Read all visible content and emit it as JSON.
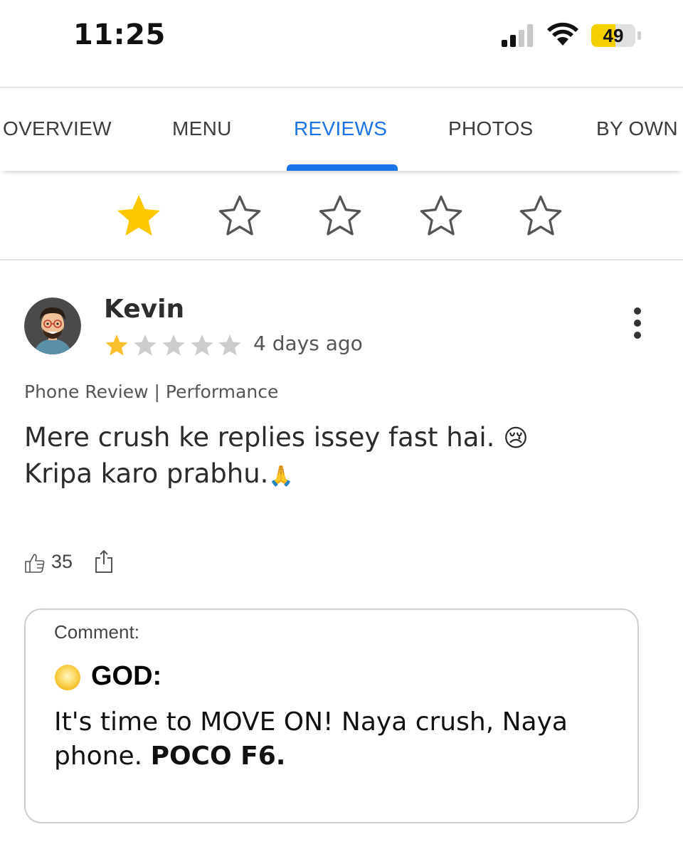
{
  "status_bar": {
    "time": "11:25",
    "battery_level": "49",
    "signal_bars": 2,
    "battery_color": "#f5d000"
  },
  "tabs": [
    {
      "label": "OVERVIEW",
      "active": false
    },
    {
      "label": "MENU",
      "active": false
    },
    {
      "label": "REVIEWS",
      "active": true
    },
    {
      "label": "PHOTOS",
      "active": false
    },
    {
      "label": "BY OWN",
      "active": false
    }
  ],
  "star_filter": {
    "selected": 1,
    "total": 5
  },
  "review": {
    "reviewer_name": "Kevin",
    "rating": 1,
    "rating_max": 5,
    "date": "4 days ago",
    "tags": "Phone Review | Performance",
    "text_line1": "Mere crush ke replies issey fast hai.",
    "text_emoji1": "😢",
    "text_line2": "Kripa karo prabhu.",
    "text_emoji2": "🙏",
    "like_count": "35"
  },
  "comment": {
    "label": "Comment:",
    "author": "GOD:",
    "text_plain": "It's time to MOVE ON! Naya crush, Naya phone.",
    "text_bold": "POCO F6."
  },
  "colors": {
    "accent_blue": "#1a73e8",
    "star_gold": "#fbc02d",
    "star_grey": "#c8c8c8"
  }
}
